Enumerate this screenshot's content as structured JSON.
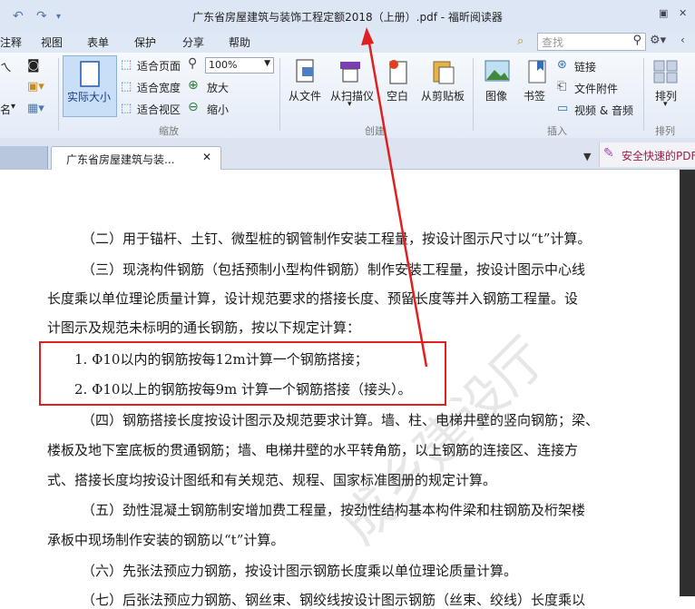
{
  "window": {
    "title": "广东省房屋建筑与装饰工程定额2018（上册）.pdf - 福昕阅读器"
  },
  "menu": {
    "items": [
      "注释",
      "视图",
      "表单",
      "保护",
      "分享",
      "帮助"
    ]
  },
  "search": {
    "placeholder": "查找"
  },
  "ribbon": {
    "actual_size": "实际大小",
    "fit_page": "适合页面",
    "fit_width": "适合宽度",
    "fit_view": "适合视区",
    "zoom_value": "100%",
    "zoom_in": "放大",
    "zoom_out": "缩小",
    "zoom_group": "缩放",
    "name_fragment": "名",
    "from_file": "从文件",
    "from_scanner": "从扫描仪",
    "blank": "空白",
    "from_clipboard": "从剪贴板",
    "create_group": "创建",
    "image": "图像",
    "bookmark": "书签",
    "link": "链接",
    "file_attachment": "文件附件",
    "video_audio": "视频 & 音频",
    "insert_group": "插入",
    "arrange": "排列",
    "arrange_group": "排列"
  },
  "tabs": {
    "doc_tab": "广东省房屋建筑与装...",
    "ad": "安全快速的PDF"
  },
  "document": {
    "p1": "（二）用于锚杆、土钉、微型桩的钢管制作安装工程量，按设计图示尺寸以“t”计算。",
    "p2a": "（三）现浇构件钢筋（包括预制小型构件钢筋）制作安装工程量，按设计图示中心线",
    "p2b": "长度乘以单位理论质量计算，设计规范要求的搭接长度、预留长度等并入钢筋工程量。设",
    "p2c": "计图示及规范未标明的通长钢筋，按以下规定计算：",
    "item1": "1. Φ10以内的钢筋按每12m计算一个钢筋搭接；",
    "item2": "2. Φ10以上的钢筋按每9m 计算一个钢筋搭接（接头）。",
    "p3a": "（四）钢筋搭接长度按设计图示及规范要求计算。墙、柱、电梯井壁的竖向钢筋；梁、",
    "p3b": "楼板及地下室底板的贯通钢筋；墙、电梯井壁的水平转角筋，以上钢筋的连接区、连接方",
    "p3c": "式、搭接长度均按设计图纸和有关规范、规程、国家标准图册的规定计算。",
    "p4a": "（五）劲性混凝土钢筋制安增加费工程量，按劲性结构基本构件梁和柱钢筋及桁架楼",
    "p4b": "承板中现场制作安装的钢筋以“t”计算。",
    "p5": "（六）先张法预应力钢筋，按设计图示钢筋长度乘以单位理论质量计算。",
    "p6": "（七）后张法预应力钢筋、钢丝束、钢绞线按设计图示钢筋（丝束、绞线）长度乘以"
  },
  "watermark": "成乡建设厅",
  "colors": {
    "annotation_red": "#e02020",
    "ribbon_bg": "#e3ebf6",
    "selected_button": "#c9def7"
  }
}
